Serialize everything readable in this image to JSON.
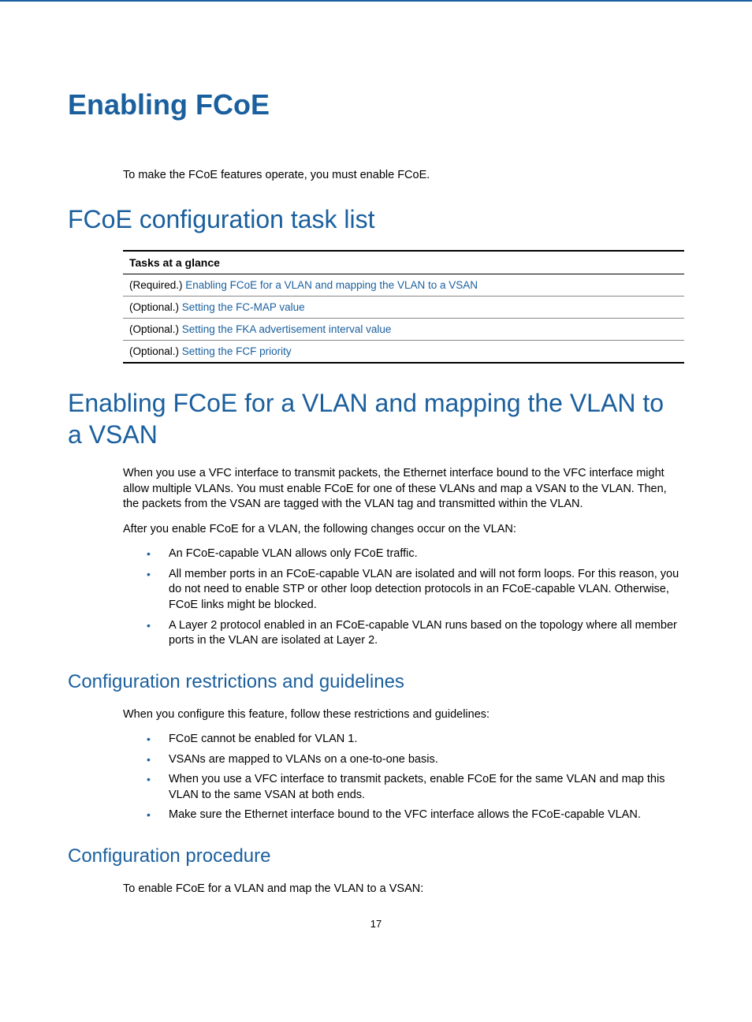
{
  "page": {
    "main_title": "Enabling FCoE",
    "intro": "To make the FCoE features operate, you must enable FCoE.",
    "page_number": "17"
  },
  "task_list": {
    "heading": "FCoE configuration task list",
    "header": "Tasks at a glance",
    "rows": [
      {
        "label": "(Required.) ",
        "link": "Enabling FCoE for a VLAN and mapping the VLAN to a VSAN"
      },
      {
        "label": "(Optional.) ",
        "link": "Setting the FC-MAP value"
      },
      {
        "label": "(Optional.) ",
        "link": "Setting the FKA advertisement interval value"
      },
      {
        "label": "(Optional.) ",
        "link": "Setting the FCF priority"
      }
    ]
  },
  "enable_section": {
    "heading": "Enabling FCoE for a VLAN and mapping the VLAN to a VSAN",
    "para1": "When you use a VFC interface to transmit packets, the Ethernet interface bound to the VFC interface might allow multiple VLANs. You must enable FCoE for one of these VLANs and map a VSAN to the VLAN. Then, the packets from the VSAN are tagged with the VLAN tag and transmitted within the VLAN.",
    "para2": "After you enable FCoE for a VLAN, the following changes occur on the VLAN:",
    "bullets1": [
      "An FCoE-capable VLAN allows only FCoE traffic.",
      "All member ports in an FCoE-capable VLAN are isolated and will not form loops. For this reason, you do not need to enable STP or other loop detection protocols in an FCoE-capable VLAN. Otherwise, FCoE links might be blocked.",
      "A Layer 2 protocol enabled in an FCoE-capable VLAN runs based on the topology where all member ports in the VLAN are isolated at Layer 2."
    ]
  },
  "restrictions": {
    "heading": "Configuration restrictions and guidelines",
    "para": "When you configure this feature, follow these restrictions and guidelines:",
    "bullets": [
      "FCoE cannot be enabled for VLAN 1.",
      "VSANs are mapped to VLANs on a one-to-one basis.",
      "When you use a VFC interface to transmit packets, enable FCoE for the same VLAN and map this VLAN to the same VSAN at both ends.",
      "Make sure the Ethernet interface bound to the VFC interface allows the FCoE-capable VLAN."
    ]
  },
  "procedure": {
    "heading": "Configuration procedure",
    "para": "To enable FCoE for a VLAN and map the VLAN to a VSAN:"
  }
}
